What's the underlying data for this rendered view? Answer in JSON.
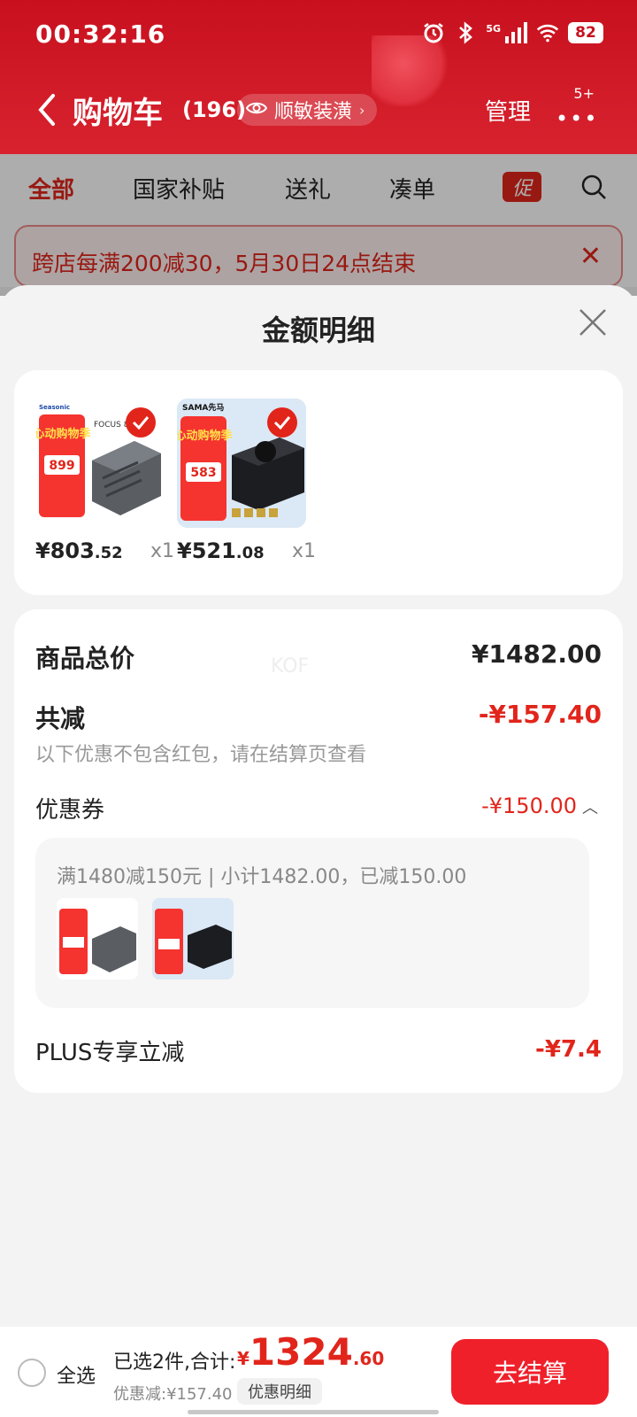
{
  "status_bar": {
    "time": "00:32:16",
    "network": "5G",
    "battery": "82"
  },
  "header": {
    "title": "购物车",
    "count": "(196)",
    "address_chip": "顺敏装潢",
    "manage_label": "管理",
    "more_badge": "5+"
  },
  "tabs": [
    {
      "label": "全部",
      "active": true
    },
    {
      "label": "国家补贴"
    },
    {
      "label": "送礼"
    },
    {
      "label": "凑单"
    }
  ],
  "promo_tab_label": "促",
  "banner": {
    "text": "跨店每满200减30，5月30日24点结束"
  },
  "modal": {
    "title": "金额明细",
    "products": [
      {
        "price_int": "¥803",
        "price_dec": ".52",
        "qty": "x1",
        "brand": "Seasonic",
        "model": "FOCUS 850W",
        "badge_text": "心动购物季",
        "promo_price": "899"
      },
      {
        "price_int": "¥521",
        "price_dec": ".08",
        "qty": "x1",
        "brand": "SAMA先马",
        "badge_text": "心动购物季",
        "promo_price": "583"
      }
    ],
    "summary": {
      "goods_total_label": "商品总价",
      "goods_total_value": "¥1482.00",
      "watermark": "KOF",
      "total_discount_label": "共减",
      "total_discount_value": "-¥157.40",
      "note": "以下优惠不包含红包，请在结算页查看",
      "coupon_label": "优惠券",
      "coupon_value": "-¥150.00",
      "coupon_desc": "满1480减150元 | 小计1482.00，已减150.00",
      "plus_label": "PLUS专享立减",
      "plus_value": "-¥7.4"
    }
  },
  "bottom_bar": {
    "select_all": "全选",
    "selected_text": "已选2件,合计:",
    "total_yen": "¥",
    "total_int": "1324",
    "total_dec": ".60",
    "discount_text": "优惠减:¥157.40",
    "detail_label": "优惠明细",
    "checkout_label": "去结算"
  },
  "colors": {
    "brand_red": "#e1251b",
    "header_red": "#c8101e",
    "checkout_red": "#f0202a"
  },
  "icons": [
    "back-icon",
    "eye-icon",
    "search-icon",
    "close-icon",
    "check-icon",
    "alarm-icon",
    "bluetooth-icon",
    "signal-icon",
    "wifi-icon"
  ]
}
